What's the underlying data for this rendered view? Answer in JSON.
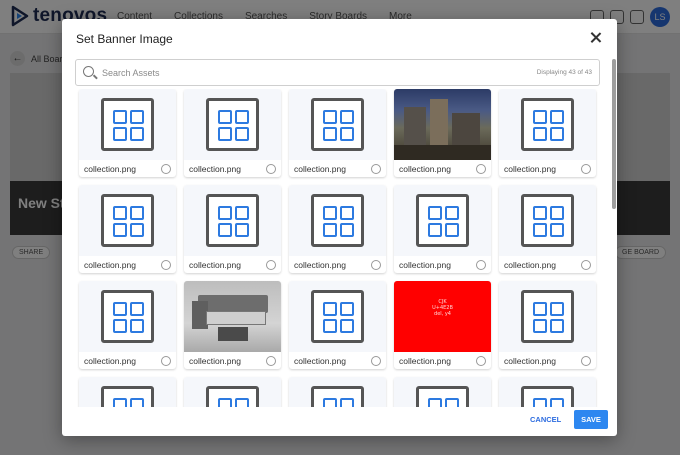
{
  "app": {
    "brand": "tenovos",
    "nav": [
      "Content",
      "Collections",
      "Searches",
      "Story Boards",
      "More"
    ],
    "avatar_initials": "LS",
    "accent_color": "#2d6cdf"
  },
  "background": {
    "back_link": "All Boards",
    "banner_title": "New Sto",
    "share_label": "SHARE",
    "manage_label": "GE BOARD"
  },
  "modal": {
    "title": "Set Banner Image",
    "search_placeholder": "Search Assets",
    "displaying": "Displaying 43 of 43",
    "cancel_label": "CANCEL",
    "save_label": "SAVE",
    "assets": [
      {
        "label": "collection.png",
        "thumb": "collection-icon"
      },
      {
        "label": "collection.png",
        "thumb": "collection-icon"
      },
      {
        "label": "collection.png",
        "thumb": "collection-icon"
      },
      {
        "label": "collection.png",
        "thumb": "city-photo"
      },
      {
        "label": "collection.png",
        "thumb": "collection-icon"
      },
      {
        "label": "collection.png",
        "thumb": "collection-icon"
      },
      {
        "label": "collection.png",
        "thumb": "collection-icon"
      },
      {
        "label": "collection.png",
        "thumb": "collection-icon"
      },
      {
        "label": "collection.png",
        "thumb": "collection-icon"
      },
      {
        "label": "collection.png",
        "thumb": "collection-icon"
      },
      {
        "label": "collection.png",
        "thumb": "collection-icon"
      },
      {
        "label": "collection.png",
        "thumb": "sofa-photo"
      },
      {
        "label": "collection.png",
        "thumb": "collection-icon"
      },
      {
        "label": "collection.png",
        "thumb": "red-cjk"
      },
      {
        "label": "collection.png",
        "thumb": "collection-icon"
      },
      {
        "label": "",
        "thumb": "collection-icon"
      },
      {
        "label": "",
        "thumb": "collection-icon"
      },
      {
        "label": "",
        "thumb": "collection-icon"
      },
      {
        "label": "",
        "thumb": "collection-icon"
      },
      {
        "label": "",
        "thumb": "collection-icon"
      }
    ],
    "red_thumb_text": [
      "CJK",
      "U+4E2B",
      "del, y4"
    ]
  }
}
